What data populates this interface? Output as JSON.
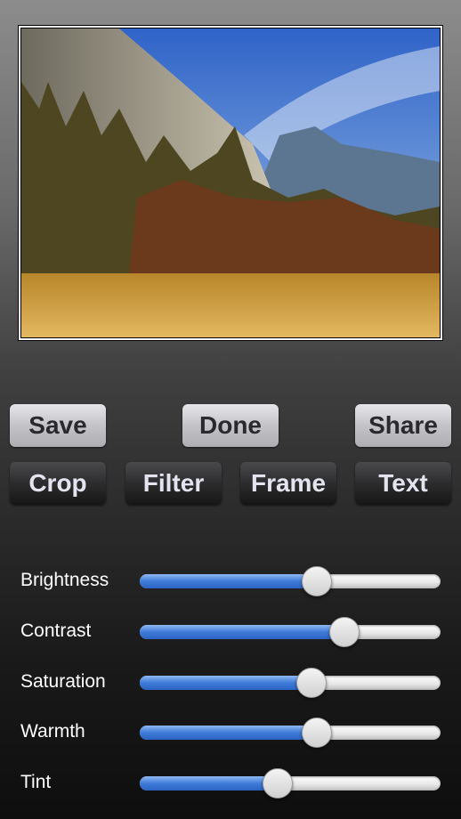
{
  "photo": {
    "description_icon": "landscape-photo"
  },
  "actions": {
    "save": "Save",
    "done": "Done",
    "share": "Share"
  },
  "tools": {
    "crop": "Crop",
    "filter": "Filter",
    "frame": "Frame",
    "text": "Text"
  },
  "adjustments": [
    {
      "label": "Brightness",
      "value": 0.59
    },
    {
      "label": "Contrast",
      "value": 0.68
    },
    {
      "label": "Saturation",
      "value": 0.57
    },
    {
      "label": "Warmth",
      "value": 0.59
    },
    {
      "label": "Tint",
      "value": 0.46
    }
  ],
  "colors": {
    "slider_fill": "#3f7bd8"
  }
}
